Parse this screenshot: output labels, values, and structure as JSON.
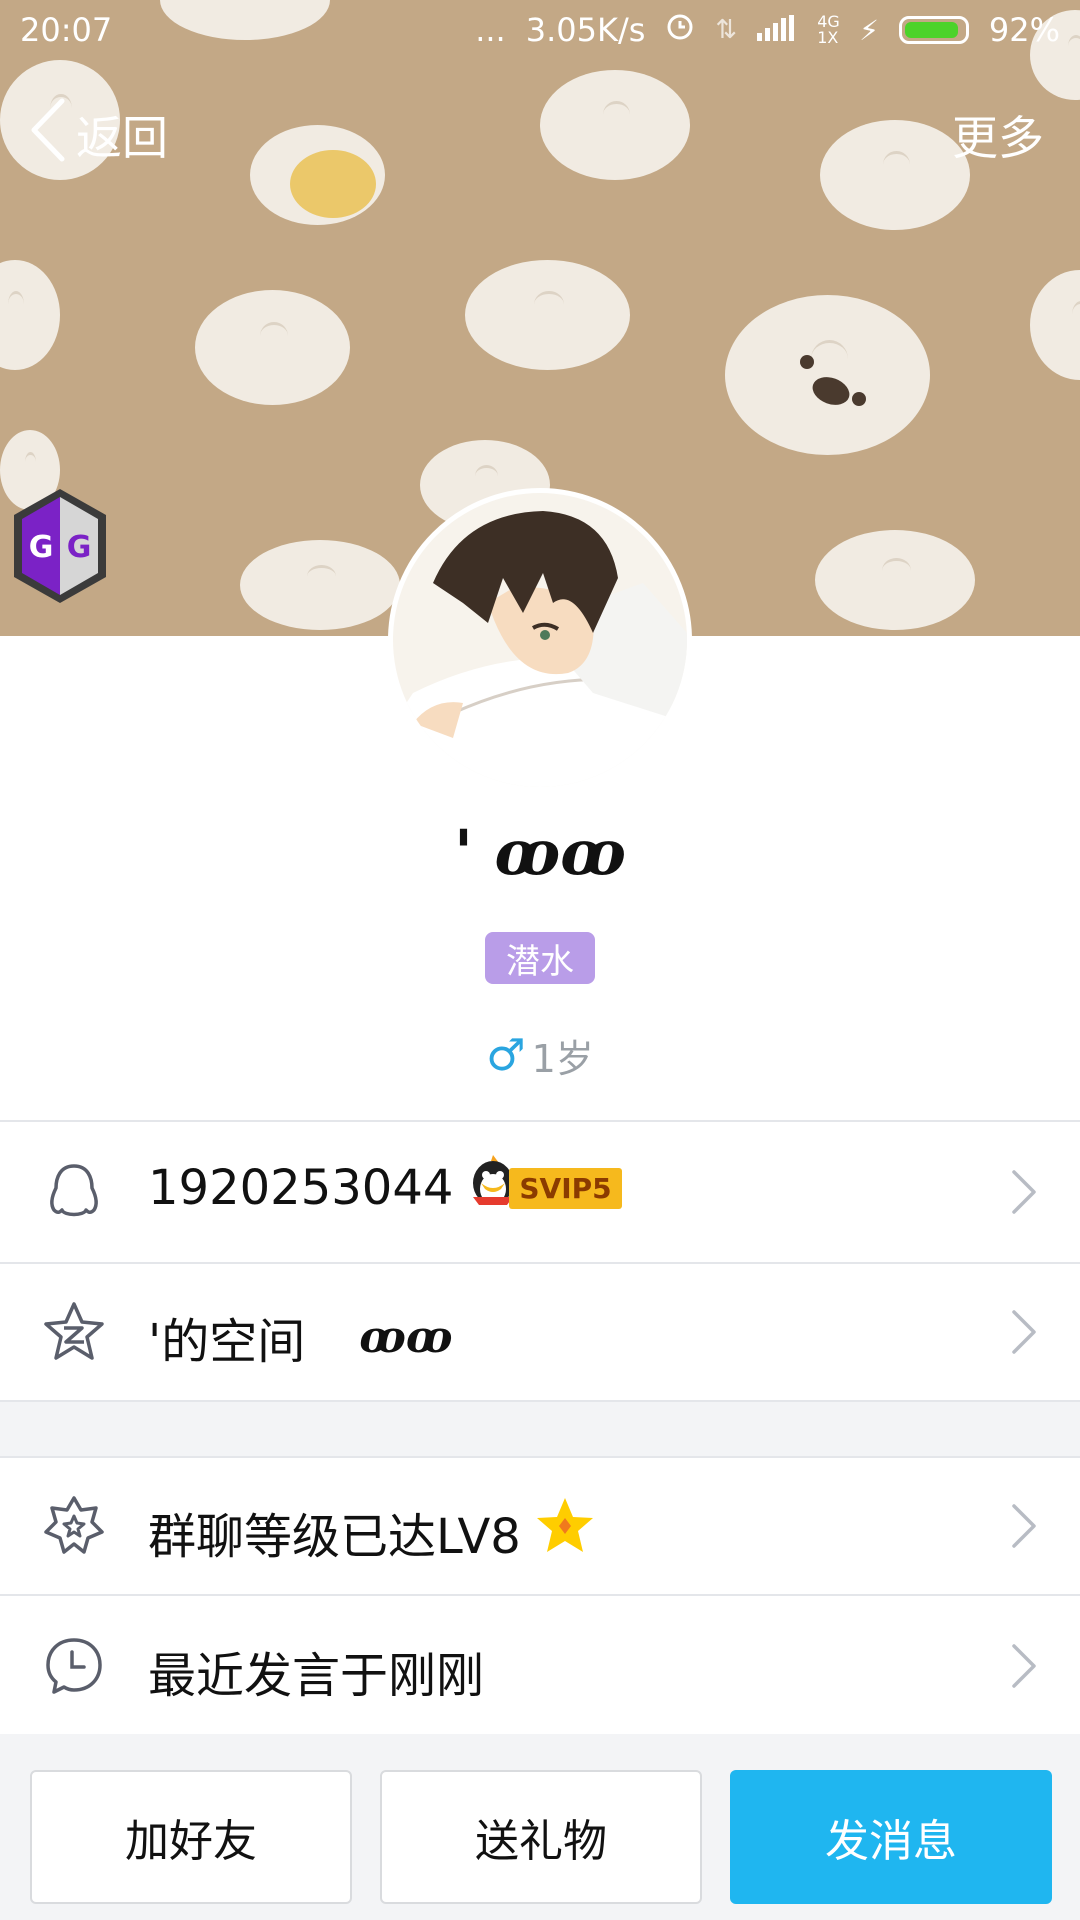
{
  "status_bar": {
    "time": "20:07",
    "dots": "...",
    "net_speed": "3.05K/s",
    "network": "4G 1X",
    "battery_pct": "92%",
    "battery_level": 0.92
  },
  "nav": {
    "back_label": "返回",
    "more_label": "更多"
  },
  "badge": {
    "app_letters": "GG"
  },
  "profile": {
    "nickname": "' ꝏꝏ",
    "role": "潜水",
    "gender_symbol": "♂",
    "age": "1岁"
  },
  "rows": {
    "qq": {
      "number": "1920253044",
      "vip": "SVIP5"
    },
    "space": {
      "label": "'的空间",
      "nick": "ꝏꝏ"
    },
    "group_level": {
      "label": "群聊等级已达LV8"
    },
    "last_speak": {
      "label": "最近发言于刚刚"
    }
  },
  "actions": {
    "add_friend": "加好友",
    "send_gift": "送礼物",
    "send_message": "发消息"
  },
  "colors": {
    "cover_bg": "#c3a886",
    "role_badge": "#b99de8",
    "primary": "#1fb6f0",
    "gender": "#2aa5e0"
  }
}
